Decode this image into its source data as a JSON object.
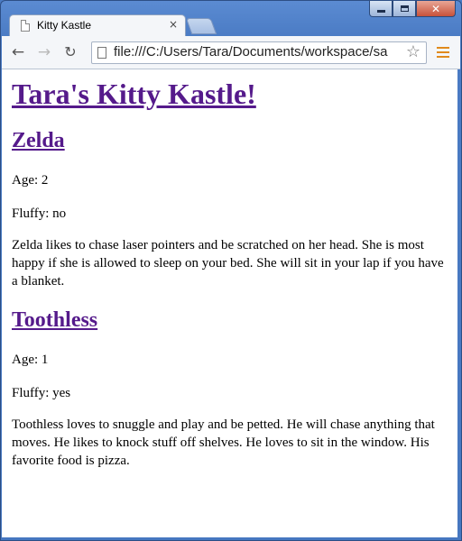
{
  "browser": {
    "tab_title": "Kitty Kastle",
    "tab_close": "×",
    "url": "file:///C:/Users/Tara/Documents/workspace/sa",
    "window_controls": {
      "minimize": "minimize-icon",
      "maximize": "maximize-icon",
      "close": "✕"
    },
    "icons": {
      "back": "←",
      "forward": "→",
      "reload": "↻",
      "star": "☆"
    }
  },
  "page": {
    "heading": "Tara's Kitty Kastle!",
    "cats": [
      {
        "name": "Zelda",
        "age": "Age: 2",
        "fluffy": "Fluffy: no",
        "description": "Zelda likes to chase laser pointers and be scratched on her head. She is most happy if she is allowed to sleep on your bed. She will sit in your lap if you have a blanket."
      },
      {
        "name": "Toothless",
        "age": "Age: 1",
        "fluffy": "Fluffy: yes",
        "description": "Toothless loves to snuggle and play and be petted. He will chase anything that moves. He likes to knock stuff off shelves. He loves to sit in the window. His favorite food is pizza."
      }
    ]
  }
}
